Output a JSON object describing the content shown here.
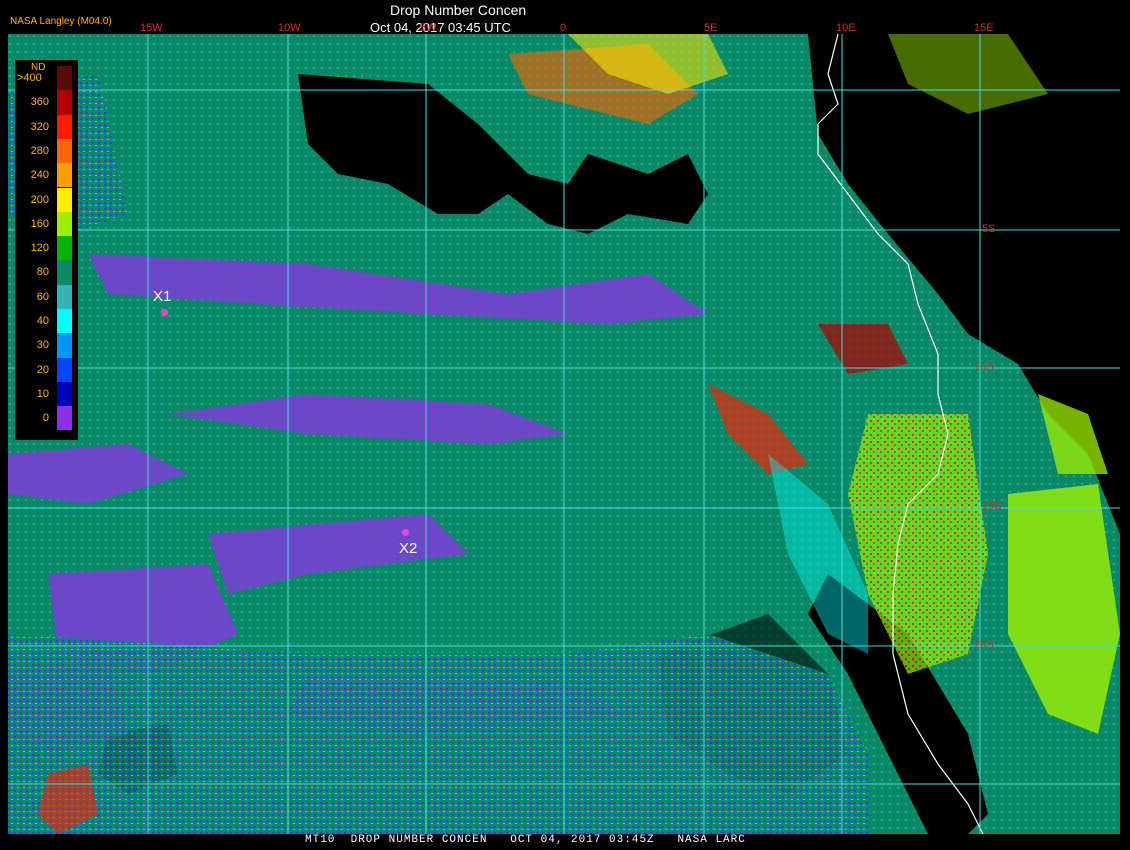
{
  "header": {
    "title": "Drop Number Concen",
    "datetime": "Oct 04, 2017 03:45 UTC",
    "producer": "NASA Langley (M04.0)"
  },
  "legend": {
    "title": "ND",
    "entries": [
      {
        "label": ">400",
        "color": "#5a0a0a"
      },
      {
        "label": "360",
        "color": "#b00000"
      },
      {
        "label": "320",
        "color": "#ff1a00"
      },
      {
        "label": "280",
        "color": "#ff6400"
      },
      {
        "label": "240",
        "color": "#ffa000"
      },
      {
        "label": "200",
        "color": "#ffee00"
      },
      {
        "label": "160",
        "color": "#9ef000"
      },
      {
        "label": "120",
        "color": "#00b400"
      },
      {
        "label": "80",
        "color": "#0a8a64"
      },
      {
        "label": "60",
        "color": "#30b4b4"
      },
      {
        "label": "40",
        "color": "#00ffff"
      },
      {
        "label": "30",
        "color": "#0096ff"
      },
      {
        "label": "20",
        "color": "#0046ff"
      },
      {
        "label": "10",
        "color": "#0000b4"
      },
      {
        "label": "0",
        "color": "#8c32e6"
      }
    ]
  },
  "grid": {
    "longitude_labels": [
      "15W",
      "10W",
      "5W",
      "0",
      "5E",
      "10E",
      "15E"
    ],
    "latitude_labels": [
      "5S",
      "10S",
      "15S",
      "20S"
    ],
    "color": "#3fe0e0"
  },
  "markers": [
    {
      "label": "X1",
      "color": "#ff3fd0"
    },
    {
      "label": "X2",
      "color": "#ff3fd0"
    }
  ],
  "footer": "MT10  DROP NUMBER CONCEN   OCT 04, 2017 03:45Z   NASA LARC"
}
